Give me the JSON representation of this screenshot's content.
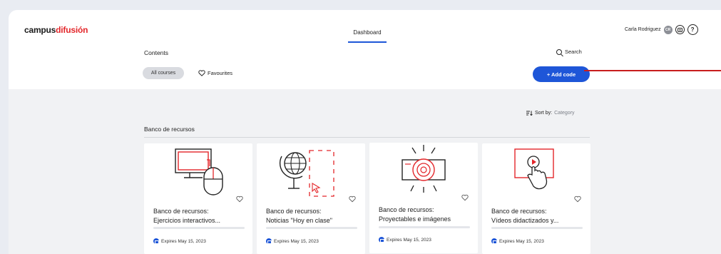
{
  "brand": {
    "part_a": "campus",
    "part_b": "difusión"
  },
  "nav": {
    "tab_dashboard": "Dashboard"
  },
  "user": {
    "name": "Carla Rodriguez",
    "initials": "CR",
    "help_glyph": "?"
  },
  "contents": {
    "title": "Contents",
    "search_label": "Search",
    "filters": {
      "all_courses": "All courses",
      "favourites": "Favourites"
    },
    "add_code": "+ Add code",
    "sort_prefix": "Sort by:",
    "sort_value": "Category"
  },
  "section": {
    "title": "Banco de recursos"
  },
  "cards": [
    {
      "title_line1": "Banco de recursos:",
      "title_line2": "Ejercicios interactivos...",
      "expires": "Expires May 15, 2023",
      "icon": "computer-mouse-icon"
    },
    {
      "title_line1": "Banco de recursos:",
      "title_line2": "Noticias \"Hoy en clase\"",
      "expires": "Expires May 15, 2023",
      "icon": "globe-icon"
    },
    {
      "title_line1": "Banco de recursos:",
      "title_line2": "Proyectables e imágenes",
      "expires": "Expires May 15, 2023",
      "icon": "projector-icon"
    },
    {
      "title_line1": "Banco de recursos:",
      "title_line2": "Vídeos didactizados y...",
      "expires": "Expires May 15, 2023",
      "icon": "video-tap-icon"
    }
  ],
  "colors": {
    "accent": "#1e56d8",
    "brand_red": "#e3262a",
    "annotation": "#c81e1e"
  }
}
